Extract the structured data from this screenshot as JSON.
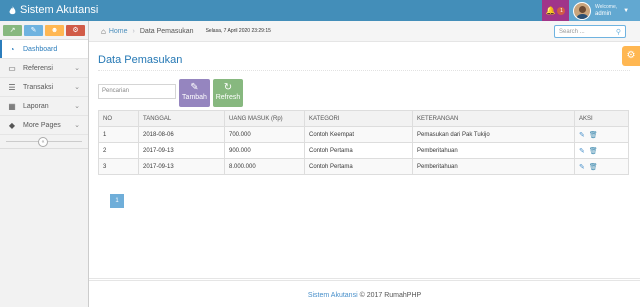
{
  "navbar": {
    "brand": "Sistem Akutansi",
    "notification_count": "1",
    "user_welcome": "Welcome,",
    "user_name": "admin"
  },
  "sidebar": {
    "items": [
      {
        "label": "Dashboard",
        "icon": "tachometer-icon"
      },
      {
        "label": "Referensi",
        "icon": "desktop-icon"
      },
      {
        "label": "Transaksi",
        "icon": "list-icon"
      },
      {
        "label": "Laporan",
        "icon": "calendar-icon"
      },
      {
        "label": "More Pages",
        "icon": "tag-icon"
      }
    ]
  },
  "breadcrumbs": {
    "home": "Home",
    "current": "Data Pemasukan",
    "datetime": "Selasa, 7 April 2020 23:29:15"
  },
  "search": {
    "placeholder": "Search ..."
  },
  "page": {
    "title": "Data Pemasukan",
    "filter_placeholder": "Pencarian",
    "tambah_label": "Tambah",
    "refresh_label": "Refresh"
  },
  "table": {
    "headers": [
      "NO",
      "TANGGAL",
      "UANG MASUK (Rp)",
      "KATEGORI",
      "KETERANGAN",
      "AKSI"
    ],
    "rows": [
      [
        "1",
        "2018-08-06",
        "700.000",
        "Contoh Keempat",
        "Pemasukan dari Pak Tukijo"
      ],
      [
        "2",
        "2017-09-13",
        "900.000",
        "Contoh Pertama",
        "Pemberitahuan"
      ],
      [
        "3",
        "2017-09-13",
        "8.000.000",
        "Contoh Pertama",
        "Pemberitahuan"
      ]
    ]
  },
  "pagination": {
    "current": "1"
  },
  "footer": {
    "app": "Sistem Akutansi",
    "copyright": "© 2017 RumahPHP"
  },
  "colors": {
    "navbar": "#438eb9",
    "accent": "#2679b5",
    "tambah": "#9585bf",
    "refresh": "#87b87f",
    "settings": "#ffb752"
  }
}
